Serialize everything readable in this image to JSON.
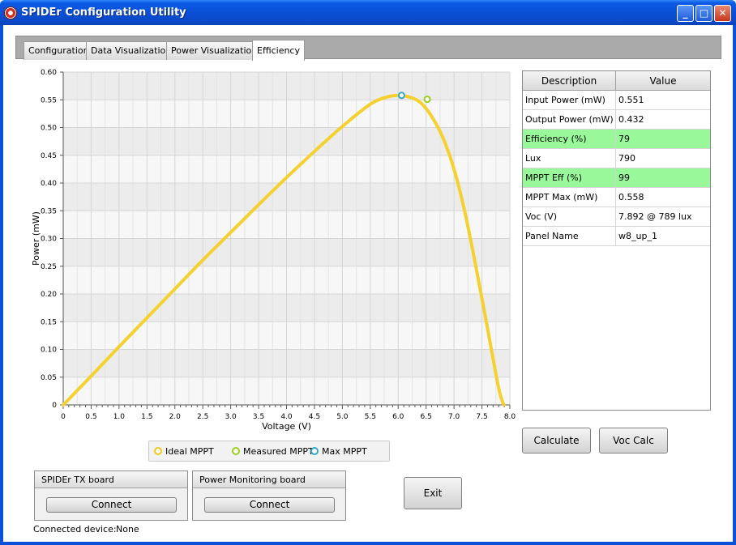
{
  "window": {
    "title": "SPIDEr Configuration Utility",
    "icon": "spider-logo-icon",
    "controls": {
      "minimize": "_",
      "maximize": "□",
      "close": "✕"
    }
  },
  "tabs": [
    {
      "label": "Configuration"
    },
    {
      "label": "Data Visualization"
    },
    {
      "label": "Power Visualization"
    },
    {
      "label": "Efficiency",
      "active": true
    }
  ],
  "chart_data": {
    "type": "line",
    "xlabel": "Voltage (V)",
    "ylabel": "Power (mW)",
    "xlim": [
      0,
      8.0
    ],
    "ylim": [
      0,
      0.6
    ],
    "xticks": [
      "0",
      "0.5",
      "1.0",
      "1.5",
      "2.0",
      "2.5",
      "3.0",
      "3.5",
      "4.0",
      "4.5",
      "5.0",
      "5.5",
      "6.0",
      "6.5",
      "7.0",
      "7.5",
      "8.0"
    ],
    "yticks": [
      "0",
      "0.05",
      "0.10",
      "0.15",
      "0.20",
      "0.25",
      "0.30",
      "0.35",
      "0.40",
      "0.45",
      "0.50",
      "0.55",
      "0.60"
    ],
    "grid": true,
    "legend_placement": "bottom",
    "series": [
      {
        "name": "Ideal MPPT",
        "color": "#f5d130",
        "x": [
          0,
          0.5,
          1.0,
          1.5,
          2.0,
          2.5,
          3.0,
          3.5,
          4.0,
          4.5,
          5.0,
          5.5,
          5.8,
          6.0,
          6.2,
          6.4,
          6.6,
          6.8,
          7.0,
          7.2,
          7.4,
          7.6,
          7.8,
          7.892
        ],
        "y": [
          0,
          0.052,
          0.105,
          0.157,
          0.209,
          0.261,
          0.311,
          0.361,
          0.41,
          0.457,
          0.502,
          0.542,
          0.555,
          0.558,
          0.555,
          0.545,
          0.52,
          0.482,
          0.425,
          0.345,
          0.245,
          0.138,
          0.03,
          0
        ]
      }
    ],
    "markers": [
      {
        "name": "Measured MPPT",
        "color": "#9ccc20",
        "x": 6.52,
        "y": 0.551
      },
      {
        "name": "Max MPPT",
        "color": "#35a8c8",
        "x": 6.06,
        "y": 0.558
      }
    ]
  },
  "legend": [
    {
      "label": "Ideal MPPT",
      "color": "#f5c518"
    },
    {
      "label": "Measured MPPT",
      "color": "#9ccc20"
    },
    {
      "label": "Max MPPT",
      "color": "#35a8c8"
    }
  ],
  "table": {
    "headers": [
      "Description",
      "Value"
    ],
    "rows": [
      {
        "desc": "Input Power (mW)",
        "value": "0.551",
        "highlight": false
      },
      {
        "desc": "Output Power (mW)",
        "value": "0.432",
        "highlight": false
      },
      {
        "desc": "Efficiency (%)",
        "value": "79",
        "highlight": true
      },
      {
        "desc": "Lux",
        "value": "790",
        "highlight": false
      },
      {
        "desc": "MPPT Eff (%)",
        "value": "99",
        "highlight": true
      },
      {
        "desc": "MPPT Max (mW)",
        "value": "0.558",
        "highlight": false
      },
      {
        "desc": "Voc (V)",
        "value": "7.892 @ 789 lux",
        "highlight": false
      },
      {
        "desc": "Panel Name",
        "value": "w8_up_1",
        "highlight": false
      }
    ],
    "highlight_color": "#99f899"
  },
  "buttons": {
    "calculate": "Calculate",
    "voc_calc": "Voc Calc",
    "exit": "Exit"
  },
  "groups": {
    "tx_board": {
      "title": "SPIDEr TX board",
      "connect": "Connect"
    },
    "power_board": {
      "title": "Power Monitoring board",
      "connect": "Connect"
    }
  },
  "status": {
    "label": "Connected device:",
    "value": "None"
  }
}
